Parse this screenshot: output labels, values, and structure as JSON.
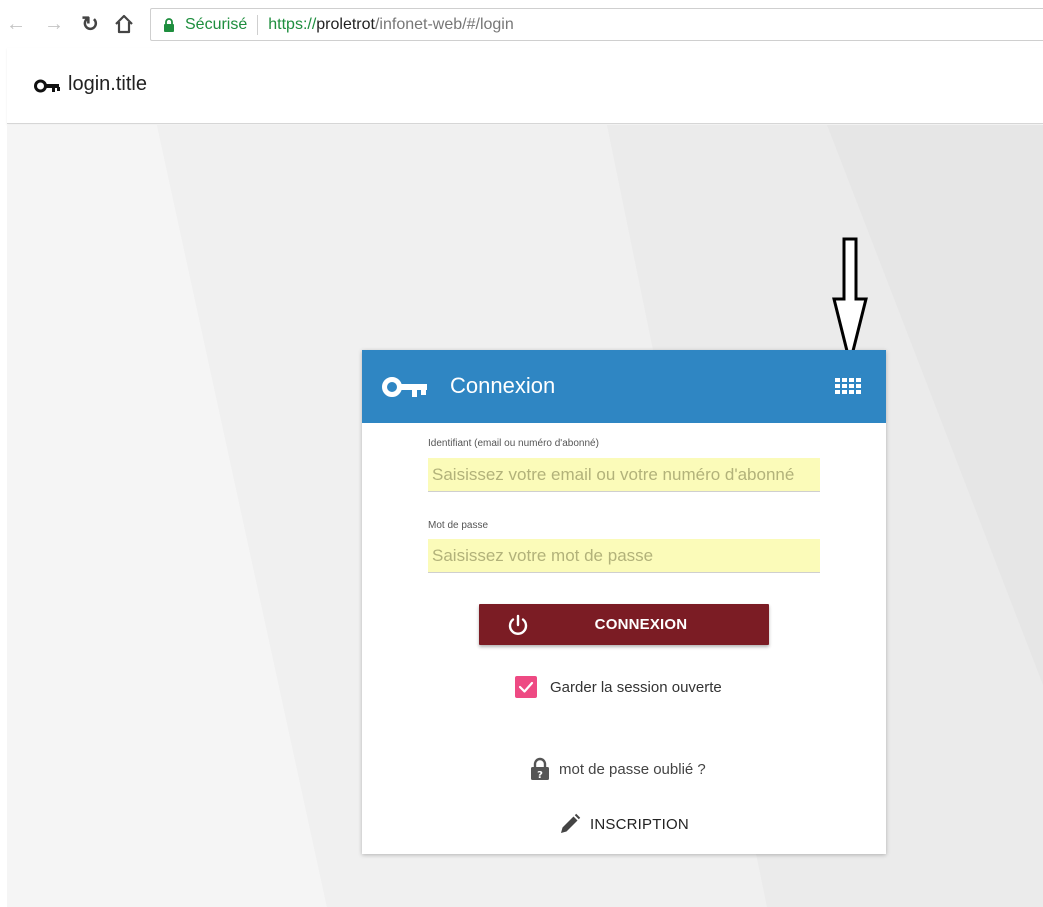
{
  "browser": {
    "secure_label": "Sécurisé",
    "url_scheme": "https://",
    "url_host": "proletrot",
    "url_path": "/infonet-web/#/login",
    "icons": [
      "back-arrow-icon",
      "forward-arrow-icon",
      "reload-icon",
      "home-icon",
      "lock-icon"
    ]
  },
  "header": {
    "title": "login.title",
    "icon": "key-icon"
  },
  "card": {
    "title": "Connexion",
    "header_color": "#2f86c3",
    "identifier": {
      "label": "Identifiant (email ou numéro d'abonné)",
      "placeholder": "Saisissez votre email ou votre numéro d'abonné",
      "value": ""
    },
    "password": {
      "label": "Mot de passe",
      "placeholder": "Saisissez votre mot de passe",
      "value": ""
    },
    "connect_button": {
      "label": "CONNEXION",
      "color": "#7b1c24",
      "icon": "power-icon"
    },
    "remember": {
      "label": "Garder la session ouverte",
      "checked": true,
      "color": "#ee4a83"
    },
    "forgot_password": {
      "label": "mot de passe oublié ?",
      "icon": "lock-icon"
    },
    "signup": {
      "label": "INSCRIPTION",
      "icon": "pencil-icon"
    },
    "apps_icon": "apps-grid-icon"
  },
  "annotation": {
    "icon": "down-arrow-annotation"
  }
}
